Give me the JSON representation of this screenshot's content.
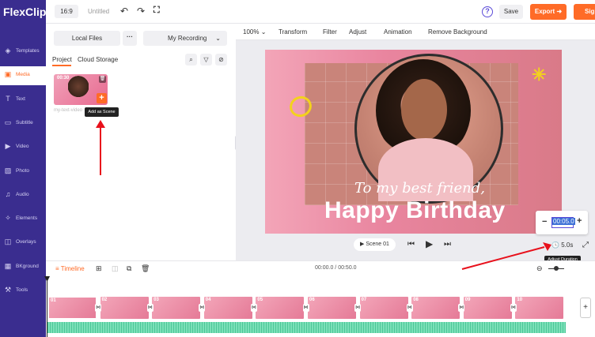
{
  "app": {
    "logo": "FlexClip"
  },
  "topbar": {
    "ratio": "16:9",
    "title": "Untitled",
    "save_label": "Save",
    "export_label": "Export",
    "signin_label": "Sign"
  },
  "sidebar": {
    "items": [
      {
        "label": "Templates",
        "icon": "templates-icon",
        "glyph": "◈"
      },
      {
        "label": "Media",
        "icon": "media-icon",
        "glyph": "▣"
      },
      {
        "label": "Text",
        "icon": "text-icon",
        "glyph": "T"
      },
      {
        "label": "Subtitle",
        "icon": "subtitle-icon",
        "glyph": "▭"
      },
      {
        "label": "Video",
        "icon": "video-icon",
        "glyph": "▶"
      },
      {
        "label": "Photo",
        "icon": "photo-icon",
        "glyph": "▨"
      },
      {
        "label": "Audio",
        "icon": "audio-icon",
        "glyph": "♫"
      },
      {
        "label": "Elements",
        "icon": "elements-icon",
        "glyph": "✧"
      },
      {
        "label": "Overlays",
        "icon": "overlays-icon",
        "glyph": "◫"
      },
      {
        "label": "BKground",
        "icon": "background-icon",
        "glyph": "▦"
      },
      {
        "label": "Tools",
        "icon": "tools-icon",
        "glyph": "⚒"
      }
    ],
    "active": "Media"
  },
  "media_panel": {
    "tab_local": "Local Files",
    "tab_more": "···",
    "tab_record": "My Recording",
    "sub_project": "Project",
    "sub_cloud": "Cloud Storage",
    "thumb_duration": "00:30",
    "thumb_name": "my-text-video",
    "tooltip": "Add as Scene"
  },
  "preview_toolbar": {
    "zoom": "100%",
    "items": [
      "Transform",
      "Filter",
      "Adjust",
      "Animation",
      "Remove Background"
    ]
  },
  "canvas": {
    "subtitle": "To my best friend,",
    "title": "Happy Birthday"
  },
  "player": {
    "scene_label": "Scene",
    "scene_num": "01",
    "duration_value": "00:05.0",
    "duration_display": "5.0s",
    "duration_tooltip": "Adjust Duration"
  },
  "timeline": {
    "label": "Timeline",
    "time": "00:00.0 / 00:50.0",
    "clips": [
      "01",
      "02",
      "03",
      "04",
      "05",
      "06",
      "07",
      "08",
      "09",
      "10"
    ]
  },
  "colors": {
    "accent": "#ff6b27",
    "sidebar": "#3a2d8f",
    "annotation": "#e8101b"
  }
}
